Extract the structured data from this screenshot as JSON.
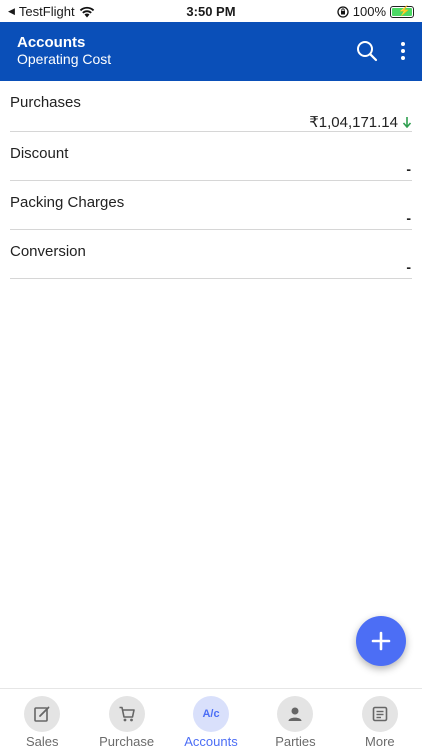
{
  "status_bar": {
    "carrier": "TestFlight",
    "time": "3:50 PM",
    "battery": "100%"
  },
  "header": {
    "title": "Accounts",
    "subtitle": "Operating Cost"
  },
  "accounts": [
    {
      "label": "Purchases",
      "value": "₹1,04,171.14"
    },
    {
      "label": "Discount",
      "value": "-"
    },
    {
      "label": "Packing Charges",
      "value": "-"
    },
    {
      "label": "Conversion",
      "value": "-"
    }
  ],
  "nav": {
    "sales": "Sales",
    "purchase": "Purchase",
    "accounts": "Accounts",
    "accounts_icon": "A/c",
    "parties": "Parties",
    "more": "More"
  },
  "colors": {
    "header_bg": "#0a4fb8",
    "accent": "#4c6ef5",
    "down_arrow": "#2e9e4f"
  }
}
